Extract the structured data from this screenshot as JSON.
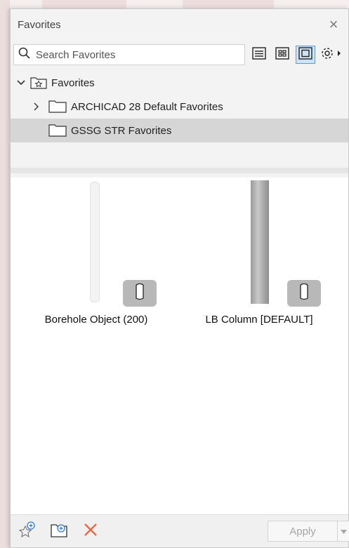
{
  "window": {
    "title": "Favorites",
    "close_glyph": "×"
  },
  "search": {
    "placeholder": "Search Favorites",
    "icon": "search-icon"
  },
  "toolbar": {
    "buttons": [
      {
        "icon": "list-view-icon",
        "active": false
      },
      {
        "icon": "grid-view-icon",
        "active": false
      },
      {
        "icon": "preview-view-icon",
        "active": true
      },
      {
        "icon": "gear-icon",
        "active": false
      }
    ]
  },
  "tree": {
    "root": {
      "label": "Favorites",
      "expanded": true,
      "icon": "star-folder-icon"
    },
    "children": [
      {
        "label": "ARCHICAD 28 Default Favorites",
        "expanded": false,
        "has_children": true,
        "selected": false
      },
      {
        "label": "GSSG STR Favorites",
        "has_children": false,
        "selected": true
      }
    ]
  },
  "items": [
    {
      "label": "Borehole Object (200)",
      "thumbnail": "white-cylinder",
      "badge_icon": "column-tool-icon"
    },
    {
      "label": "LB Column [DEFAULT]",
      "thumbnail": "concrete-column",
      "badge_icon": "column-tool-icon"
    }
  ],
  "bottom": {
    "apply_label": "Apply",
    "icons": [
      "new-favorite-icon",
      "new-folder-icon",
      "delete-icon"
    ],
    "accent_delete": "#e8694a",
    "accent_add": "#2f7ad6"
  }
}
